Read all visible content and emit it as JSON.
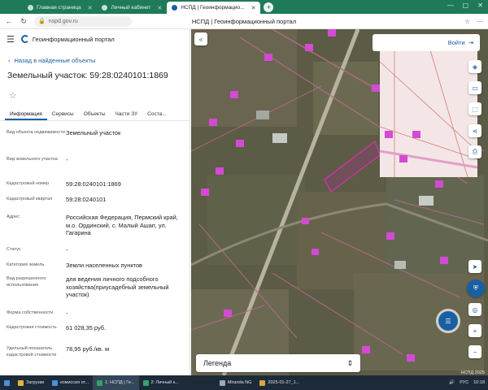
{
  "browser": {
    "tabs": [
      {
        "label": "Главная страница"
      },
      {
        "label": "Личный кабинет"
      },
      {
        "label": "НСПД | Геоинформацио..."
      }
    ],
    "new_tab": "+",
    "url": "nspd.gov.ru",
    "page_title": "НСПД | Геоинформационный портал"
  },
  "portal": {
    "name": "Геоинформационный портал",
    "back_label": "Назад в найденные объекты",
    "object_title": "Земельный участок: 59:28:0240101:1869",
    "tabs": [
      "Информация",
      "Сервисы",
      "Объекты",
      "Части ЗУ",
      "Соста..."
    ],
    "rows": [
      {
        "label": "Вид объекта недвижимости",
        "value": "Земельный участок"
      },
      {
        "label": "Вид земельного участка",
        "value": "-"
      },
      {
        "label": "Кадастровый номер",
        "value": "59:28:0240101:1869"
      },
      {
        "label": "Кадастровый квартал",
        "value": "59:28:0240101"
      },
      {
        "label": "Адрес",
        "value": "Российская Федерация, Пермский край, м.о. Ординский, с. Малый Ашап, ул. Гагарина"
      },
      {
        "label": "Статус",
        "value": "-"
      },
      {
        "label": "Категория земель",
        "value": "Земли населенных пунктов"
      },
      {
        "label": "Вид разрешенного использования",
        "value": "для ведения личного подсобного хозяйства(приусадебный земельный участок)"
      },
      {
        "label": "Форма собственности",
        "value": "-"
      },
      {
        "label": "Кадастровая стоимость",
        "value": "61 028,35 руб."
      },
      {
        "label": "Удельный показатель кадастровой стоимости",
        "value": "78,95 руб./кв. м"
      }
    ]
  },
  "map": {
    "login_label": "Войти",
    "legend_label": "Легенда",
    "attribution": "НСПД 2025"
  },
  "taskbar": {
    "items": [
      "Загрузки",
      "комиссия от...",
      "1: НСПД | Ге...",
      "2: Личный к...",
      "Miranda NG",
      "2025-01-27_1..."
    ],
    "lang": "РУС",
    "time": "10:18"
  }
}
